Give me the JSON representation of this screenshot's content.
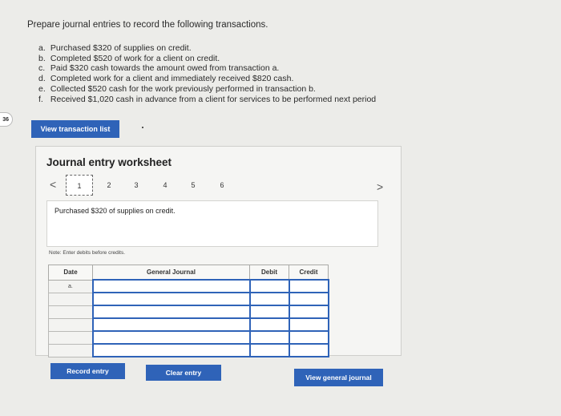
{
  "prompt": {
    "title": "Prepare journal entries to record the following transactions.",
    "transactions": [
      {
        "letter": "a.",
        "text": "Purchased $320 of supplies on credit."
      },
      {
        "letter": "b.",
        "text": "Completed $520 of work for a client on credit."
      },
      {
        "letter": "c.",
        "text": "Paid $320 cash towards the amount owed from transaction a."
      },
      {
        "letter": "d.",
        "text": "Completed work for a client and immediately received $820 cash."
      },
      {
        "letter": "e.",
        "text": "Collected $520 cash for the work previously performed in transaction b."
      },
      {
        "letter": "f.",
        "text": "Received $1,020 cash in advance from a client for services to be performed next period"
      }
    ]
  },
  "question_badge": "36",
  "view_transaction_list_label": "View transaction list",
  "worksheet": {
    "title": "Journal entry worksheet",
    "prev_arrow": "<",
    "next_arrow": ">",
    "tabs": [
      "1",
      "2",
      "3",
      "4",
      "5",
      "6"
    ],
    "active_tab": "1",
    "description": "Purchased $320 of supplies on credit.",
    "note": "Note: Enter debits before credits.",
    "table": {
      "headers": {
        "date": "Date",
        "journal": "General Journal",
        "debit": "Debit",
        "credit": "Credit"
      },
      "first_date": "a."
    },
    "buttons": {
      "record": "Record entry",
      "clear": "Clear entry",
      "view_general_journal": "View general journal"
    }
  },
  "colors": {
    "accent": "#2f63b8",
    "background": "#ecece9"
  }
}
